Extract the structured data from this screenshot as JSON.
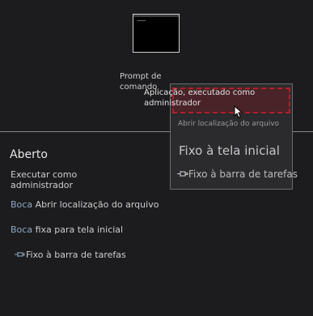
{
  "tile": {
    "app_name": "Prompt de comando"
  },
  "context_menu": {
    "run_as_admin": "Aplicação, executado como administrador",
    "open_file_location": "Abrir localização do arquivo",
    "pin_to_start": "Fixo à tela inicial",
    "pin_to_taskbar": "Fixo à barra de tarefas",
    "pin_icon": "pin-icon"
  },
  "jump_list": {
    "section_title": "Aberto",
    "items": [
      {
        "prefix": "",
        "label": "Executar como administrador"
      },
      {
        "prefix": "Boca",
        "label": "Abrir localização do arquivo"
      },
      {
        "prefix": "Boca",
        "label": "fixa para tela inicial"
      },
      {
        "prefix": "",
        "label": "Fixo à barra de tarefas",
        "icon": "pin-icon"
      }
    ]
  },
  "colors": {
    "background": "#1c1c1e",
    "highlight_border": "#b0202a",
    "menu_background": "#2b2b2d"
  }
}
